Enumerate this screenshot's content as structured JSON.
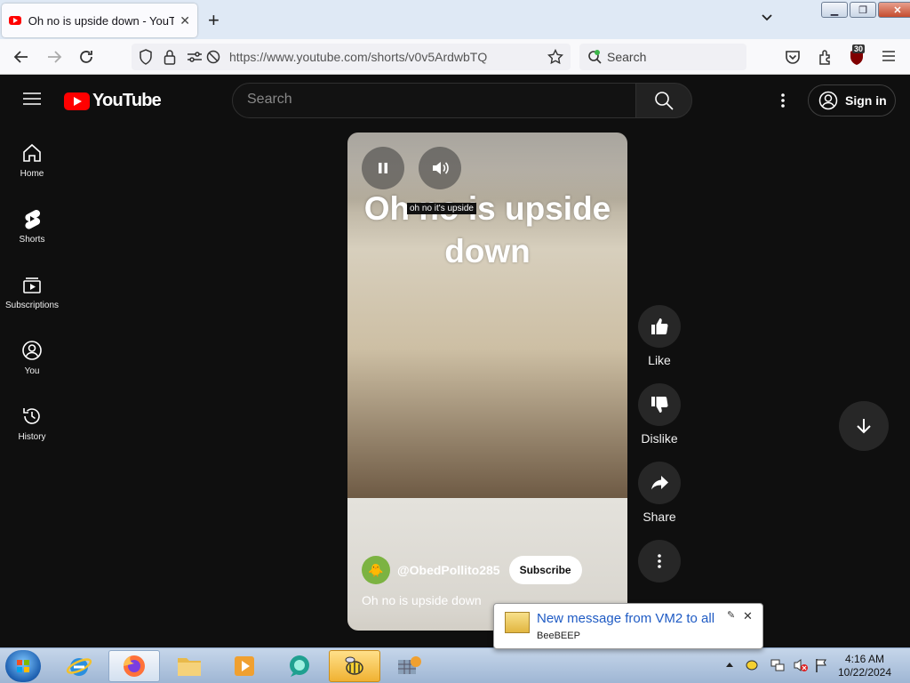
{
  "browser": {
    "tab_title": "Oh no is upside down - YouTube",
    "tab_close": "✕",
    "new_tab": "+",
    "url": "https://www.youtube.com/shorts/v0v5ArdwbTQ",
    "search_placeholder": "Search",
    "extension_badge": "30"
  },
  "youtube": {
    "logo_text": "YouTube",
    "search_placeholder": "Search",
    "sign_in": "Sign in",
    "sidebar": [
      {
        "label": "Home",
        "icon": "home-icon"
      },
      {
        "label": "Shorts",
        "icon": "shorts-icon"
      },
      {
        "label": "Subscriptions",
        "icon": "subscriptions-icon"
      },
      {
        "label": "You",
        "icon": "you-icon"
      },
      {
        "label": "History",
        "icon": "history-icon"
      }
    ]
  },
  "video": {
    "overlay_text": "Oh no is upside down",
    "caption": "oh no it's upside",
    "channel_name": "@ObedPollito285",
    "subscribe": "Subscribe",
    "title": "Oh no is upside down"
  },
  "actions": {
    "like": "Like",
    "dislike": "Dislike",
    "share": "Share"
  },
  "taskbar": {
    "time": "4:16 AM",
    "date": "10/22/2024"
  },
  "notification": {
    "message": "New message from VM2 to all",
    "app": "BeeBEEP"
  }
}
